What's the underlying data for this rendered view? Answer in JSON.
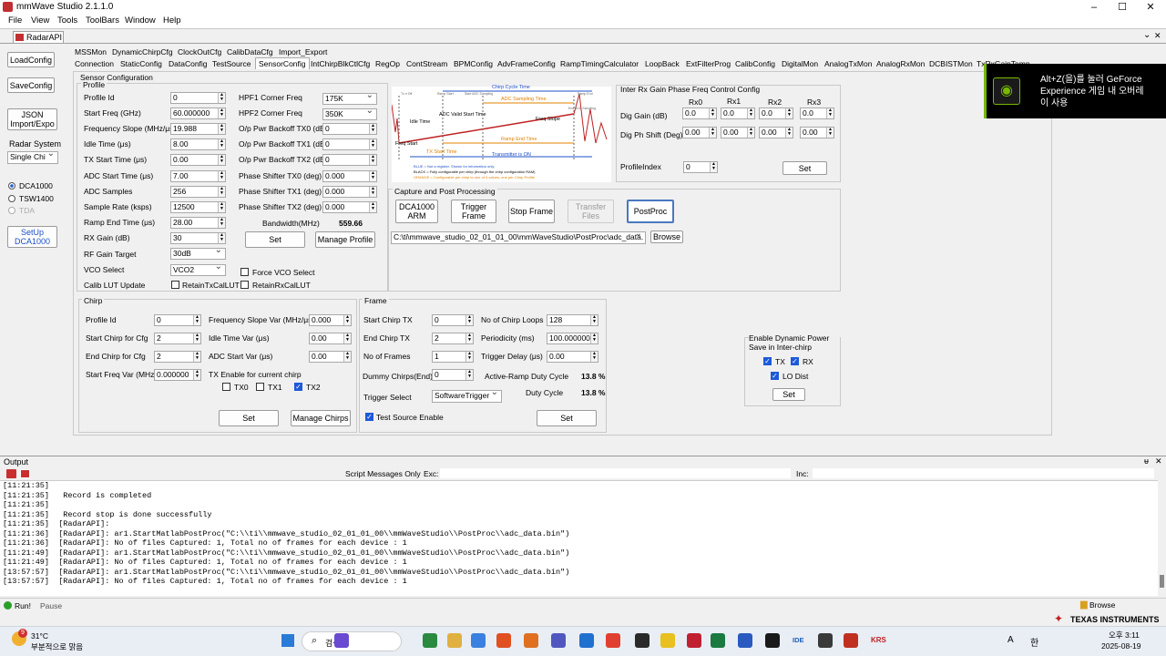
{
  "window": {
    "title": "mmWave Studio 2.1.1.0",
    "minimize": "–",
    "maximize": "☐",
    "close": "✕"
  },
  "menu": [
    "File",
    "View",
    "Tools",
    "ToolBars",
    "Window",
    "Help"
  ],
  "doc_tab": {
    "label": "RadarAPI",
    "dropdown": "⌄",
    "close": "✕"
  },
  "left": {
    "load_config": "LoadConfig",
    "save_config": "SaveConfig",
    "json": "JSON Import/Expo",
    "radar_system_label": "Radar System",
    "radar_system_value": "Single Chi",
    "dca1000": "DCA1000",
    "tsw1400": "TSW1400",
    "tda": "TDA",
    "setup": "SetUp DCA1000"
  },
  "tabs_row1": [
    "MSSMon",
    "DynamicChirpCfg",
    "ClockOutCfg",
    "CalibDataCfg",
    "Import_Export"
  ],
  "tabs_row2": [
    "Connection",
    "StaticConfig",
    "DataConfig",
    "TestSource",
    "SensorConfig",
    "IntChirpBlkCtlCfg",
    "RegOp",
    "ContStream",
    "BPMConfig",
    "AdvFrameConfig",
    "RampTimingCalculator",
    "LoopBack",
    "ExtFilterProg",
    "CalibConfig",
    "DigitalMon",
    "AnalogTxMon",
    "AnalogRxMon",
    "DCBISTMon",
    "TxRxGainTemp"
  ],
  "sensor": {
    "title": "Sensor Configuration",
    "profile_title": "Profile",
    "profile_labels": [
      "Profile Id",
      "Start Freq (GHz)",
      "Frequency Slope (MHz/μs)",
      "Idle Time (μs)",
      "TX Start Time (μs)",
      "ADC Start Time (μs)",
      "ADC Samples",
      "Sample Rate (ksps)",
      "Ramp End Time (μs)",
      "RX Gain (dB)",
      "RF Gain Target",
      "VCO Select",
      "Calib LUT Update"
    ],
    "profile_values": [
      "0",
      "60.000000",
      "19.988",
      "8.00",
      "0.00",
      "7.00",
      "256",
      "12500",
      "28.00",
      "30"
    ],
    "rf_gain_target": "30dB",
    "vco_select": "VCO2",
    "retain_tx": "RetainTxCalLUT",
    "retain_rx": "RetainRxCalLUT",
    "force_vco": "Force VCO Select",
    "right_labels": [
      "HPF1 Corner Freq",
      "HPF2 Corner Freq",
      "O/p Pwr Backoff TX0 (dB)",
      "O/p Pwr Backoff TX1 (dB)",
      "O/p Pwr Backoff TX2 (dB)",
      "Phase Shifter TX0 (deg)",
      "Phase Shifter TX1 (deg)",
      "Phase Shifter TX2 (deg)"
    ],
    "right_values": [
      "175K",
      "350K",
      "0",
      "0",
      "0",
      "0.000",
      "0.000",
      "0.000"
    ],
    "bandwidth_label": "Bandwidth(MHz)",
    "bandwidth_value": "559.66",
    "set": "Set",
    "manage_profile": "Manage Profile"
  },
  "diagram": {
    "chirp_cycle": "Chirp Cycle Time",
    "adc_sampling": "ADC Sampling Time",
    "idle": "Idle Time",
    "adc_valid": "ADC Valid Start Time",
    "freq_slope": "Freq Slope",
    "ramp_end": "Ramp End Time",
    "tx_start": "TX Start Time",
    "freq_start": "Freq Start",
    "tx_on": "Transmitter is ON",
    "note1": "BLUE = Not a register. Shown for information only",
    "note2": "BLACK = Fully configurable per chirp (through the chirp configuration RAM)",
    "note3": "ORANGE = Configurable per chirp to one of 4 values, one per Chirp Profile",
    "small1": "Tx n Off",
    "small2": "Ramp Start",
    "small3": "Start ADC Sampling",
    "small4": "Ramp End",
    "small5": "End ADC Sampling"
  },
  "capture": {
    "title": "Capture and Post Processing",
    "dca_arm": "DCA1000 ARM",
    "trigger": "Trigger Frame",
    "stop": "Stop Frame",
    "transfer": "Transfer Files",
    "postproc": "PostProc",
    "path": "C:\\ti\\mmwave_studio_02_01_01_00\\mmWaveStudio\\PostProc\\adc_data.",
    "browse": "Browse"
  },
  "rxgain": {
    "title": "Inter Rx Gain Phase Freq Control Config",
    "cols": [
      "Rx0",
      "Rx1",
      "Rx2",
      "Rx3"
    ],
    "dig_gain": "Dig Gain (dB)",
    "dig_ph": "Dig Ph Shift (Deg)",
    "gain_vals": [
      "0.0",
      "0.0",
      "0.0",
      "0.0"
    ],
    "ph_vals": [
      "0.00",
      "0.00",
      "0.00",
      "0.00"
    ],
    "profile_index": "ProfileIndex",
    "profile_index_val": "0",
    "set": "Set"
  },
  "chirp": {
    "title": "Chirp",
    "labels": [
      "Profile Id",
      "Start Chirp for Cfg",
      "End Chirp for Cfg",
      "Start Freq Var (MHz)"
    ],
    "values": [
      "0",
      "2",
      "2",
      "0.000000"
    ],
    "labels2": [
      "Frequency Slope Var (MHz/μs)",
      "Idle Time Var (μs)",
      "ADC Start Var (μs)"
    ],
    "values2": [
      "0.000",
      "0.00",
      "0.00"
    ],
    "tx_label": "TX Enable for current chirp",
    "tx": [
      "TX0",
      "TX1",
      "TX2"
    ],
    "set": "Set",
    "manage": "Manage Chirps"
  },
  "frame": {
    "title": "Frame",
    "labels": [
      "Start Chirp TX",
      "End Chirp TX",
      "No of Frames",
      "Dummy Chirps(End)"
    ],
    "values": [
      "0",
      "2",
      "1",
      "0"
    ],
    "labels2": [
      "No of Chirp Loops",
      "Periodicity (ms)",
      "Trigger Delay (μs)"
    ],
    "values2": [
      "128",
      "100.000000",
      "0.00"
    ],
    "active_label": "Active-Ramp Duty Cycle",
    "active_val": "13.8 %",
    "duty_label": "Duty Cycle",
    "duty_val": "13.8 %",
    "trigger_select_label": "Trigger Select",
    "trigger_select": "SoftwareTrigger",
    "test_source": "Test Source Enable",
    "set": "Set"
  },
  "dynpower": {
    "title": "Enable Dynamic Power Save in Inter-chirp",
    "tx": "TX",
    "rx": "RX",
    "lo": "LO Dist",
    "set": "Set"
  },
  "output": {
    "title": "Output",
    "pin": "ᵾ",
    "close": "✕",
    "script_messages": "Script Messages Only",
    "exc": "Exc:",
    "inc": "Inc:"
  },
  "console": [
    "[11:21:35]",
    "[11:21:35]   Record is completed",
    "[11:21:35]",
    "[11:21:35]   Record stop is done successfully",
    "[11:21:35]  [RadarAPI]:",
    "[11:21:36]  [RadarAPI]: ar1.StartMatlabPostProc(\"C:\\\\ti\\\\mmwave_studio_02_01_01_00\\\\mmWaveStudio\\\\PostProc\\\\adc_data.bin\")",
    "[11:21:36]  [RadarAPI]: No of files Captured: 1, Total no of frames for each device : 1",
    "[11:21:49]  [RadarAPI]: ar1.StartMatlabPostProc(\"C:\\\\ti\\\\mmwave_studio_02_01_01_00\\\\mmWaveStudio\\\\PostProc\\\\adc_data.bin\")",
    "[11:21:49]  [RadarAPI]: No of files Captured: 1, Total no of frames for each device : 1",
    "[13:57:57]  [RadarAPI]: ar1.StartMatlabPostProc(\"C:\\\\ti\\\\mmwave_studio_02_01_01_00\\\\mmWaveStudio\\\\PostProc\\\\adc_data.bin\")",
    "[13:57:57]  [RadarAPI]: No of files Captured: 1, Total no of frames for each device : 1"
  ],
  "status": {
    "run": "Run!",
    "pause": "Pause",
    "browse": "Browse",
    "ti_logo": "TEXAS INSTRUMENTS"
  },
  "nvidia": {
    "line1": "Alt+Z(을)를 눌러 GeForce",
    "line2": "Experience 게임 내 오버레",
    "line3": "이 사용"
  },
  "taskbar": {
    "temp": "31°C",
    "weather": "부분적으로 맑음",
    "badge": "9",
    "search": "검색",
    "time_ampm": "오후 3:11",
    "date": "2025-08-19",
    "lang": "한",
    "font": "A",
    "idle": "IDE",
    "krs": "KRS"
  }
}
